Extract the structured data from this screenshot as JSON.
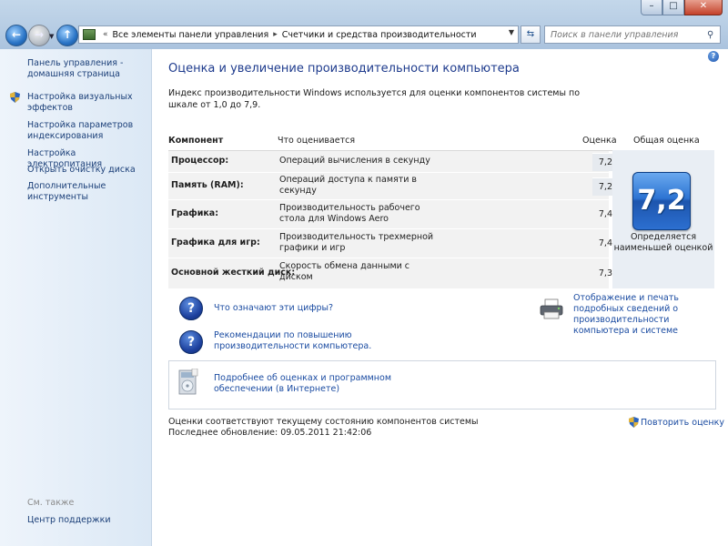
{
  "titlebar": {
    "min": "–",
    "max": "□",
    "close": "✕"
  },
  "nav": {
    "breadcrumbs": [
      "Все элементы панели управления",
      "Счетчики и средства производительности"
    ],
    "search_placeholder": "Поиск в панели управления"
  },
  "sidebar": {
    "links": [
      "Панель управления - домашняя страница",
      "Настройка визуальных эффектов",
      "Настройка параметров индексирования",
      "Настройка электропитания",
      "Открыть очистку диска",
      "Дополнительные инструменты"
    ],
    "see_also": "См. также",
    "support": "Центр поддержки"
  },
  "main": {
    "title": "Оценка и увеличение производительности компьютера",
    "description": "Индекс производительности Windows используется для оценки компонентов системы по шкале от 1,0 до 7,9.",
    "headers": {
      "component": "Компонент",
      "what": "Что оценивается",
      "score": "Оценка",
      "base": "Общая оценка"
    },
    "rows": [
      {
        "component": "Процессор:",
        "what": "Операций вычисления в секунду",
        "score": "7,2"
      },
      {
        "component": "Память (RAM):",
        "what": "Операций доступа к памяти в секунду",
        "score": "7,2"
      },
      {
        "component": "Графика:",
        "what": "Производительность рабочего стола для Windows Aero",
        "score": "7,4"
      },
      {
        "component": "Графика для игр:",
        "what": "Производительность трехмерной графики и игр",
        "score": "7,4"
      },
      {
        "component": "Основной жесткий диск:",
        "what": "Скорость обмена данными с диском",
        "score": "7,3"
      }
    ],
    "base_score": "7,2",
    "base_text": "Определяется наименьшей оценкой",
    "link_numbers": "Что означают эти цифры?",
    "link_tips": "Рекомендации по повышению производительности компьютера.",
    "link_print": "Отображение и печать подробных сведений о производительности компьютера и системе",
    "link_online": "Подробнее об оценках и программном обеспечении (в Интернете)",
    "status_line1": "Оценки соответствуют текущему состоянию компонентов системы",
    "status_line2": "Последнее обновление: 09.05.2011 21:42:06",
    "rerun": "Повторить оценку"
  }
}
